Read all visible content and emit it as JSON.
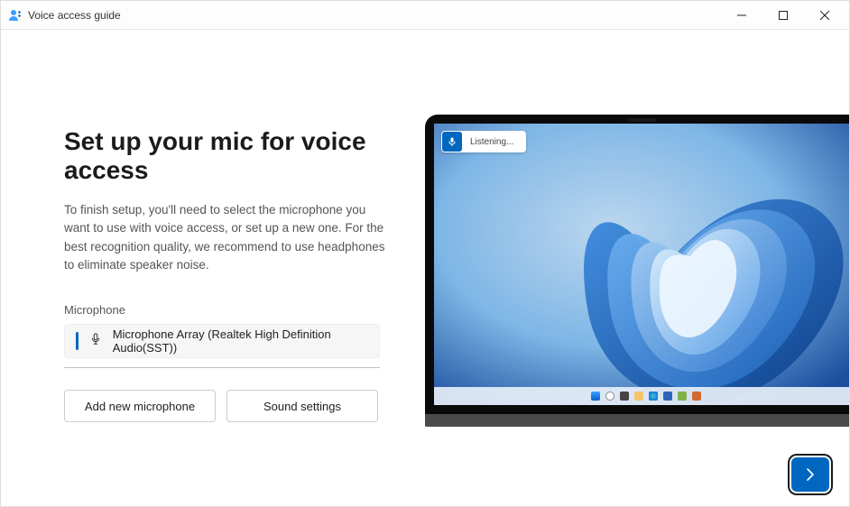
{
  "window": {
    "title": "Voice access guide"
  },
  "main": {
    "heading": "Set up your mic for voice access",
    "description": "To finish setup, you'll need to select the microphone you want to use with voice access, or set up a new one. For the best recognition quality, we recommend to use headphones to eliminate speaker noise.",
    "microphone_label": "Microphone",
    "selected_microphone": "Microphone Array (Realtek High Definition Audio(SST))",
    "add_mic_label": "Add new microphone",
    "sound_settings_label": "Sound settings"
  },
  "preview": {
    "listening_label": "Listening..."
  },
  "colors": {
    "accent": "#0067c0"
  }
}
